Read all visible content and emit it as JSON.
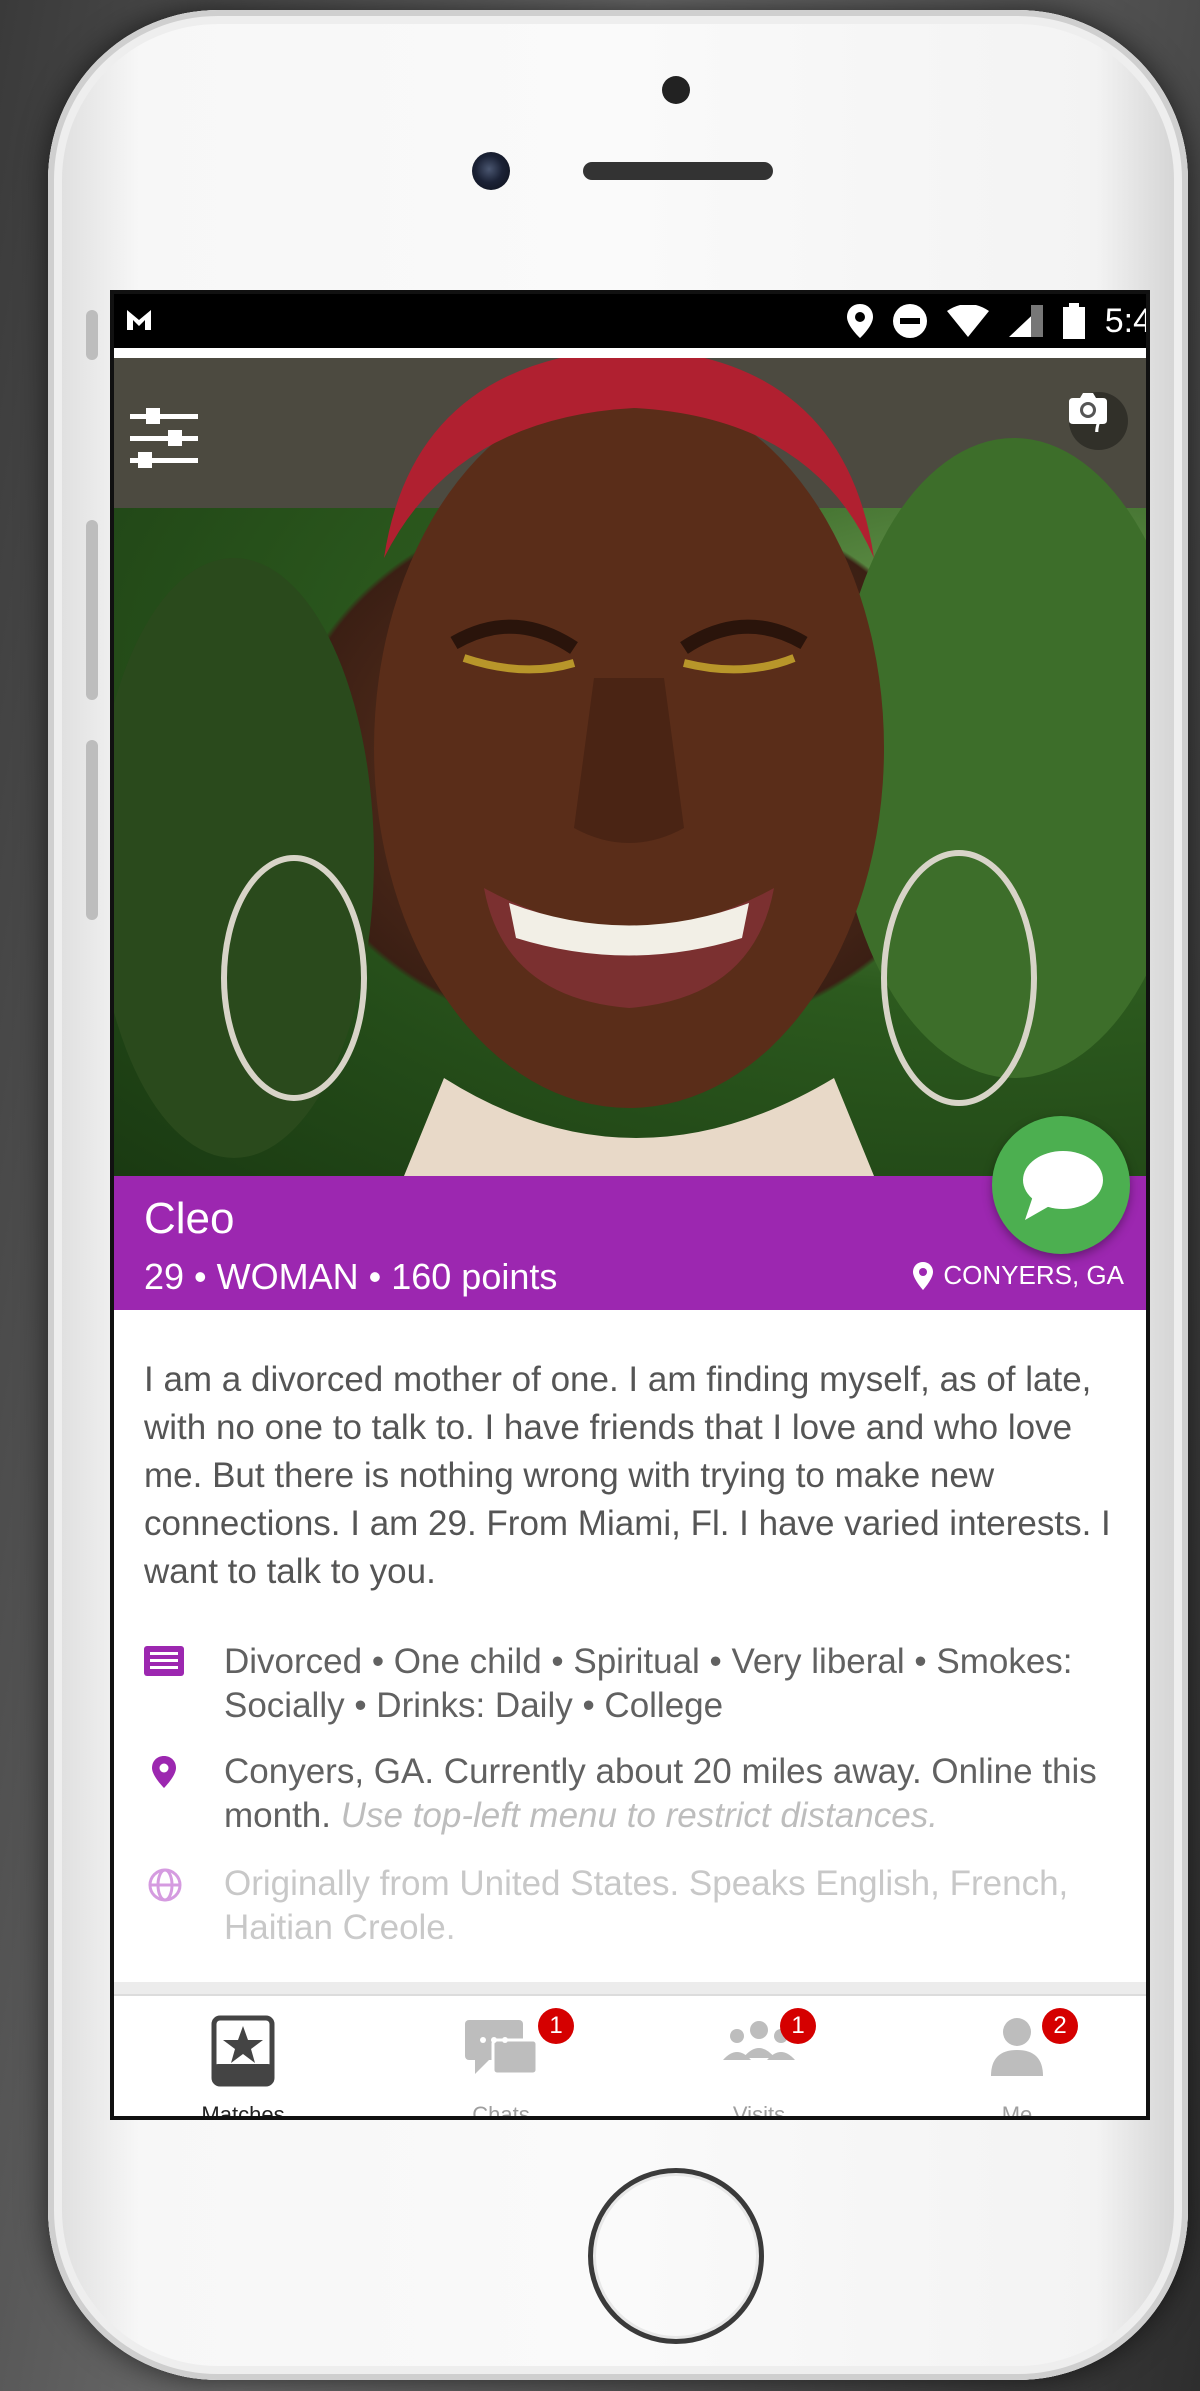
{
  "status_bar": {
    "time": "5:4"
  },
  "photo": {
    "photo_count": "7"
  },
  "profile": {
    "name": "Cleo",
    "meta": "29 • WOMAN • 160 points",
    "location": "CONYERS, GA",
    "bio": "I am a divorced mother of one. I am finding myself, as of late, with no one to talk to. I have friends that I love and who love me. But there is nothing wrong with trying to make new connections. I am 29. From Miami, Fl. I have varied interests. I want to talk to you.",
    "details": {
      "lifestyle": "Divorced • One child • Spiritual • Very liberal • Smokes: Socially • Drinks: Daily • College",
      "distance": "Conyers, GA. Currently about 20 miles away. Online this month.",
      "distance_hint": "Use top-left menu to restrict distances.",
      "origin": "Originally from United States. Speaks English, French, Haitian Creole."
    }
  },
  "nav": {
    "items": [
      {
        "label": "Matches",
        "badge": ""
      },
      {
        "label": "Chats",
        "badge": "1"
      },
      {
        "label": "Visits",
        "badge": "1"
      },
      {
        "label": "Me",
        "badge": "2"
      }
    ]
  },
  "colors": {
    "accent": "#9c27b0",
    "chat_button": "#4caf50",
    "badge": "#d50000"
  },
  "icons": {
    "filter": "sliders-icon",
    "photo_count": "camera-icon",
    "chat": "chat-bubble-icon",
    "location": "map-pin-icon",
    "lifestyle": "id-card-icon",
    "origin": "globe-icon"
  }
}
